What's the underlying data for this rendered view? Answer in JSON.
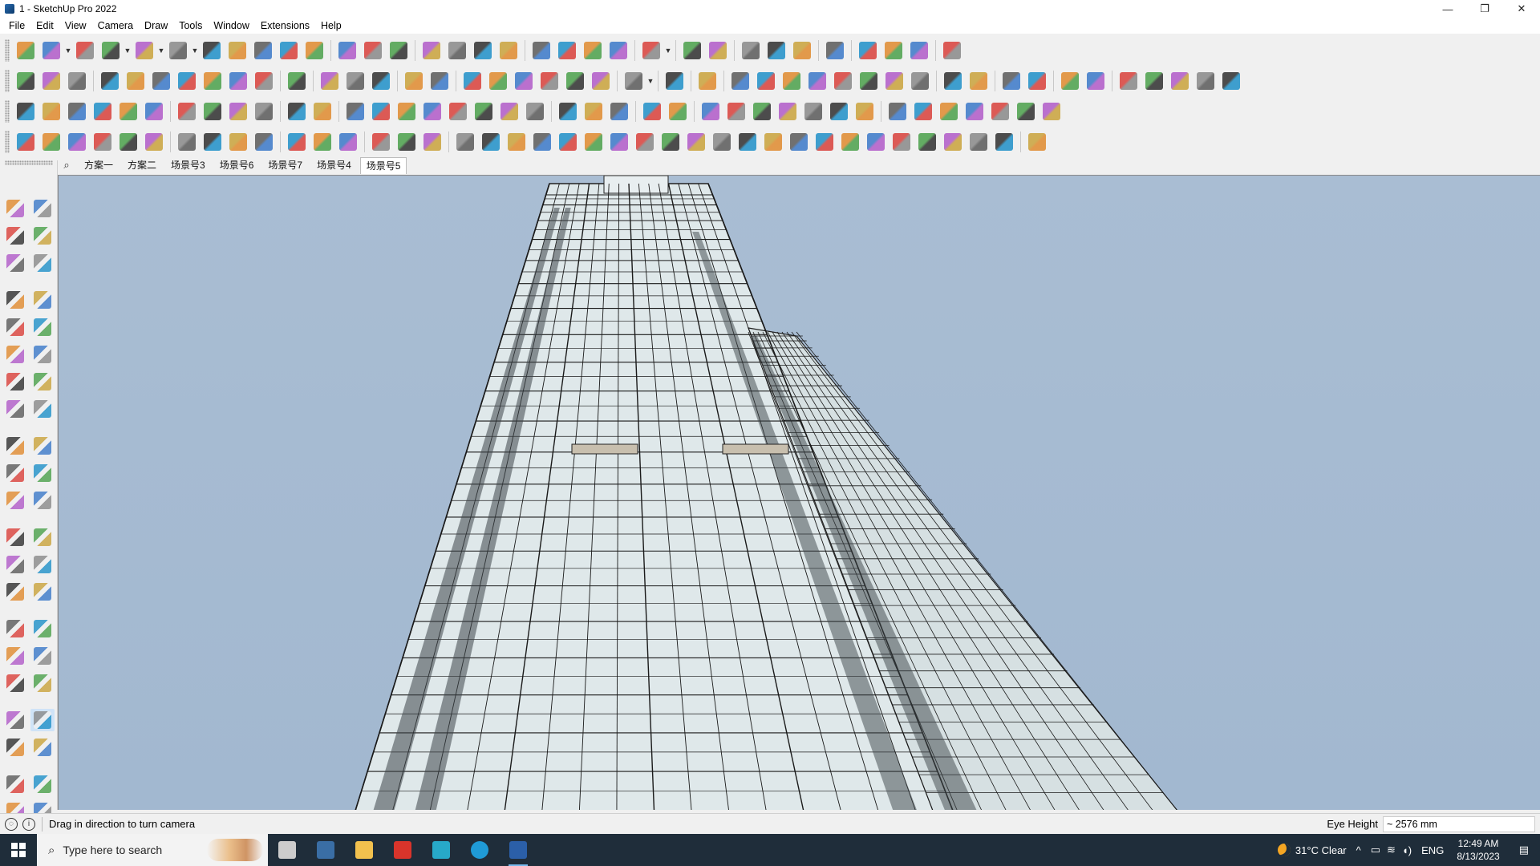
{
  "window": {
    "title": "1 - SketchUp Pro 2022",
    "minimize": "—",
    "restore": "❐",
    "close": "✕"
  },
  "menu": [
    "File",
    "Edit",
    "View",
    "Camera",
    "Draw",
    "Tools",
    "Window",
    "Extensions",
    "Help"
  ],
  "toolbar_rows": [
    [
      "search-icon",
      "select-icon",
      "drop",
      "eraser-icon",
      "line-icon",
      "drop",
      "arc-icon",
      "drop",
      "rectangle-icon",
      "drop",
      "push-pull-icon",
      "follow-me-icon",
      "move-icon",
      "rotate-icon",
      "scale-icon",
      "sep",
      "tape-measure-icon",
      "text-icon",
      "paint-bucket-icon",
      "sep",
      "orbit-icon",
      "pan-icon",
      "zoom-icon",
      "zoom-extents-icon",
      "sep",
      "warehouse-icon",
      "extension-warehouse-icon",
      "layout-icon",
      "extension-manager-icon",
      "sep",
      "user-icon",
      "drop",
      "sep",
      "component-icon",
      "group-icon",
      "sep",
      "axes-icon",
      "sort-up-icon",
      "sort-down-icon",
      "sep",
      "dimension-icon",
      "sep",
      "section-icon",
      "undo-icon",
      "redo-icon",
      "sep",
      "scene-icon"
    ],
    [
      "solid-union-icon",
      "solid-intersect-icon",
      "solid-trim-icon",
      "sep",
      "push-pull-plus-icon",
      "shape-up-icon",
      "shape-right-icon",
      "shape-v-icon",
      "shape-n-icon",
      "shape-x-icon",
      "shape-f-icon",
      "sep",
      "curve-icon",
      "sep",
      "face-icon",
      "face-split-icon",
      "face-blend-icon",
      "sep",
      "plane-icon",
      "plane-move-icon",
      "sep",
      "house-3d-icon",
      "wall-icon",
      "house-icon",
      "building-icon",
      "roof-icon",
      "store-icon",
      "sep",
      "glyph-icon",
      "drop",
      "sep",
      "leaf-icon",
      "sep",
      "pen-icon",
      "sep",
      "shape-square-icon",
      "shape-circle-icon",
      "shape-hexagon-icon",
      "shape-ellipse-icon",
      "shape-parallelogram-icon",
      "shape-trapezoid-icon",
      "shape-curve-icon",
      "shape-polygon-icon",
      "sep",
      "bezier-icon",
      "spiral-icon",
      "sep",
      "knife-icon",
      "eraser-pink-icon",
      "sep",
      "sample-a-icon",
      "sample-b-icon",
      "sep",
      "terrain-icon",
      "terrain-b-icon",
      "terrain-c-icon",
      "terrain-d-icon",
      "terrain-e-icon"
    ],
    [
      "box-blue-icon",
      "plane-blue-icon",
      "plane-yellow-icon",
      "plane-green-icon",
      "plane-red-icon",
      "plane-gray-icon",
      "sep",
      "arc-orange-icon",
      "rect-red-icon",
      "stack-icon",
      "panel-icon",
      "sep",
      "pipe-icon",
      "tube-icon",
      "sep",
      "corner-icon",
      "path-dots-icon",
      "cross-red-icon",
      "cross-green-icon",
      "cross-blue-icon",
      "cone-icon",
      "vase-icon",
      "pyramid-icon",
      "sep",
      "loop-icon",
      "knot-icon",
      "rotate-dots-icon",
      "sep",
      "sun-icon",
      "bucket-icon",
      "sep",
      "hook-icon",
      "tree-icon",
      "flip-icon",
      "tool-a-icon",
      "tool-b-icon",
      "tool-c-icon",
      "tool-d-icon",
      "sep",
      "grid-a-icon",
      "grid-b-icon",
      "grid-c-icon",
      "grid-d-icon",
      "close-red-icon",
      "circle-dots-icon",
      "layout-dots-icon"
    ],
    [
      "node-square-icon",
      "node-curve-icon",
      "node-car-icon",
      "scissors-icon",
      "gear-icon",
      "box-wire-icon",
      "sep",
      "pipe-bend-icon",
      "mesh-a-icon",
      "mesh-b-icon",
      "mesh-c-icon",
      "sep",
      "fillet-icon",
      "fillet-b-icon",
      "line-red-icon",
      "sep",
      "sweep-icon",
      "stair-icon",
      "lathe-icon",
      "sep",
      "hatch-a-icon",
      "hatch-b-icon",
      "hatch-c-icon",
      "hatch-d-icon",
      "hatch-e-icon",
      "hatch-f-icon",
      "hatch-g-icon",
      "hatch-h-icon",
      "hatch-i-icon",
      "hatch-j-icon",
      "hatch-k-icon",
      "hatch-l-icon",
      "hatch-m-icon",
      "hatch-n-icon",
      "hatch-o-icon",
      "hatch-p-icon",
      "hatch-q-icon",
      "hatch-r-icon",
      "hatch-s-icon",
      "hatch-t-icon",
      "hatch-u-icon",
      "hatch-v-icon",
      "sep",
      "house-outline-icon"
    ]
  ],
  "icon_colors": [
    "#e08a2e",
    "#3a78c8",
    "#d9403a",
    "#4aa04a",
    "#b05ac8",
    "#888888",
    "#2f2f2f",
    "#c9a23b",
    "#5a5a5a",
    "#1e90c8"
  ],
  "scene_tabs": {
    "search_glyph": "⌕",
    "tabs": [
      "方案一",
      "方案二",
      "场景号3",
      "场景号6",
      "场景号7",
      "场景号4",
      "场景号5"
    ],
    "active": "场景号5"
  },
  "left_tools": [
    "select-icon",
    "orbit-icon",
    "paint-bucket-icon",
    "eraser-icon",
    "component-icon",
    "tape-icon",
    "gap",
    "line-icon",
    "freehand-icon",
    "rectangle-icon",
    "rotated-rect-icon",
    "circle-icon",
    "polygon-icon",
    "arc-icon",
    "arc-2pt-icon",
    "arc-3pt-icon",
    "pie-icon",
    "gap",
    "move-icon",
    "push-pull-icon",
    "rotate-icon",
    "follow-me-icon",
    "scale-icon",
    "offset-icon",
    "gap",
    "tape-measure-icon",
    "dimension-icon",
    "protractor-icon",
    "text-icon",
    "axes-icon",
    "3d-text-icon",
    "gap",
    "orbit-tool-icon",
    "pan-icon",
    "zoom-icon",
    "zoom-window-icon",
    "zoom-extents-icon",
    "previous-view-icon",
    "gap",
    "position-camera-icon",
    "look-around-icon",
    "walk-icon",
    "section-plane-icon",
    "gap",
    "warehouse-icon",
    "extension-icon",
    "layout-icon",
    "stack-icon"
  ],
  "status": {
    "info_glyph": "i",
    "hint": "Drag in direction to turn camera",
    "measure_label": "Eye Height",
    "measure_value": "~ 2576 mm"
  },
  "taskbar": {
    "search_placeholder": "Type here to search",
    "apps": [
      "task-view-icon",
      "calculator-icon",
      "file-explorer-icon",
      "acrobat-icon",
      "app-3-icon",
      "edge-icon",
      "sketchup-icon"
    ],
    "weather": "31°C  Clear",
    "lang": "ENG",
    "time": "12:49 AM",
    "date": "8/13/2023",
    "chevron": "^"
  }
}
